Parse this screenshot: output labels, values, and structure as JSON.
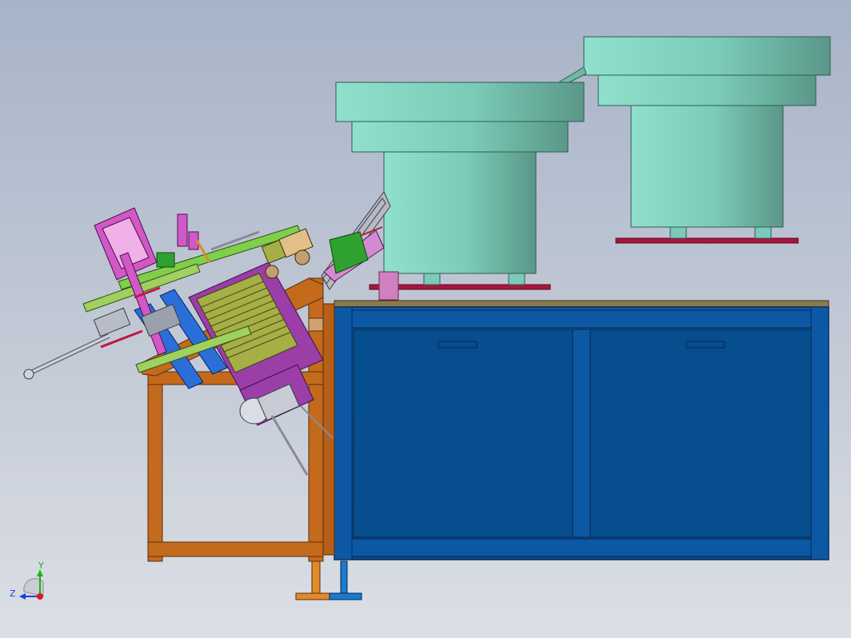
{
  "viewport": {
    "background_top": "#a7b3c8",
    "background_bottom": "#dcdfe5"
  },
  "colors": {
    "bowl_light": "#86d8c3",
    "bowl_dark": "#5c9c8c",
    "bowl_base_plate": "#a8163e",
    "cabinet_blue": "#0b4f94",
    "cabinet_edge": "#08264d",
    "frame_orange": "#c46a1d",
    "track_purple": "#9b3ea8",
    "mechanism_olive": "#a6ae46",
    "mechanism_green": "#2fa12f",
    "part_blue": "#2a6fd8",
    "part_pink": "#d258c8"
  },
  "triad": {
    "y_label": "Y",
    "z_label": "Z",
    "x_color": "#d81a1a",
    "y_color": "#19b31a",
    "z_color": "#1c3fd8"
  }
}
